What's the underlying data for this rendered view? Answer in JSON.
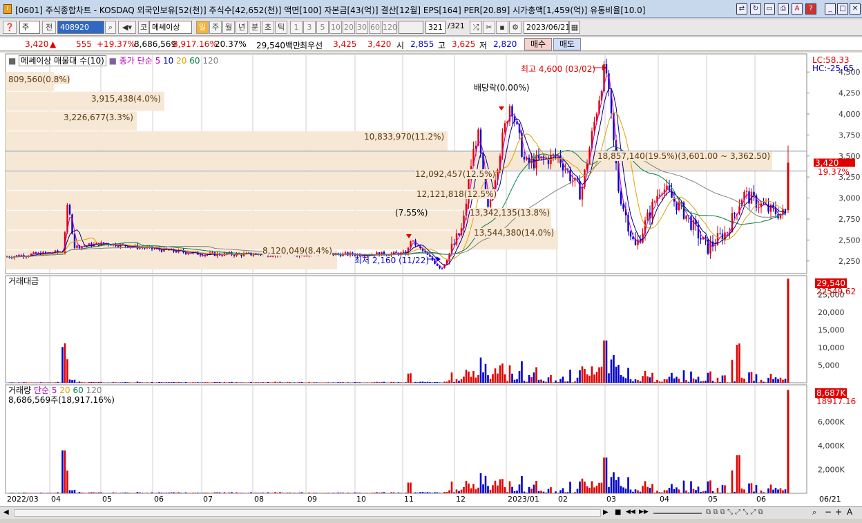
{
  "window": {
    "title": "[0601] 주식종합차트 - KOSDAQ 외국인보유[52(천)] 주식수[42,652(천)] 액면[100] 자본금[43(억)] 결산[12월] EPS[164] PER[20.89] 시가총액[1,459(억)] 유통비율[10.0]",
    "buttons": [
      "minimize",
      "restore",
      "close"
    ]
  },
  "toolbar": {
    "type_label": "주",
    "jeon_label": "전",
    "code": "408920",
    "market_label": "코",
    "stock_name": "메쎄이상",
    "periods": [
      "일",
      "주",
      "월",
      "년",
      "분",
      "초",
      "틱"
    ],
    "active_period": "일",
    "intervals": [
      "1",
      "3",
      "5",
      "10",
      "20",
      "30",
      "60",
      "120"
    ],
    "count": "321",
    "count_total": "/321",
    "date": "2023/06/21"
  },
  "info": {
    "price": "3,420",
    "change": "555",
    "change_pct": "+19.37%",
    "volume": "8,686,569",
    "volume_pct": "8,917.16%",
    "turnover": "20.37%",
    "amount": "29,540백만",
    "best_label": "최우선",
    "ask": "3,425",
    "bid": "3,420",
    "open_label": "시",
    "open": "2,855",
    "high_label": "고",
    "high": "3,625",
    "low_label": "저",
    "low": "2,820",
    "buy_label": "매수",
    "sell_label": "매도"
  },
  "price_panel": {
    "legend_volume_profile": "메쎄이상 매물대 수(10)",
    "legend_ma": "종가 단순",
    "ma_periods": [
      "5",
      "10",
      "20",
      "60",
      "120"
    ],
    "lc": "LC:58.33",
    "hc": "HC:-25.65",
    "current_price_tag": "3,420",
    "current_pct_tag": "19.37%",
    "high_annotation": "최고 4,600 (03/02)",
    "low_annotation": "최저 2,160 (11/22)",
    "dividend_annotation": "배당락(0.00%)",
    "jump_annotation": "(7.55%)"
  },
  "volume_profile": [
    {
      "label": "809,560(0.8%)"
    },
    {
      "label": "3,915,438(4.0%)"
    },
    {
      "label": "3,226,677(3.3%)"
    },
    {
      "label": "10,833,970(11.2%)"
    },
    {
      "label": "18,857,140(19.5%)(3,601.00 ~ 3,362.50)"
    },
    {
      "label": "12,092,457(12.5%)"
    },
    {
      "label": "12,121,818(12.5%)"
    },
    {
      "label": "13,342,135(13.8%)"
    },
    {
      "label": "13,544,380(14.0%)"
    },
    {
      "label": "8,120,049(8.4%)"
    }
  ],
  "amount_panel": {
    "title": "거래대금",
    "current_tag": "29,540",
    "ma_tag": "22549.62",
    "ticks": [
      "25,000",
      "20,000",
      "15,000",
      "10,000",
      "5,000"
    ]
  },
  "volume_panel": {
    "title": "거래량",
    "ma_label": "단순",
    "ma_periods": [
      "5",
      "20",
      "60",
      "120"
    ],
    "summary": "8,686,569주(18,917.16%)",
    "current_tag": "8,687K",
    "ma_tag": "18917.16",
    "ticks": [
      "6,000K",
      "4,000K",
      "2,000K"
    ]
  },
  "x_axis": [
    "2022/03",
    "04",
    "05",
    "06",
    "07",
    "08",
    "09",
    "10",
    "11",
    "12",
    "2023/01",
    "02",
    "03",
    "04",
    "05",
    "06"
  ],
  "x_axis_right": "06/21",
  "chart_data": {
    "type": "candlestick",
    "y_ticks": [
      "4,500",
      "4,250",
      "4,000",
      "3,750",
      "3,500",
      "3,250",
      "3,000",
      "2,750",
      "2,500",
      "2,250"
    ],
    "ylim": [
      2100,
      4650
    ],
    "close_path": [
      [
        "2022-03",
        2300
      ],
      [
        "2022-04-05",
        2360
      ],
      [
        "2022-04-08",
        2950
      ],
      [
        "2022-04-12",
        2420
      ],
      [
        "2022-05",
        2460
      ],
      [
        "2022-06",
        2390
      ],
      [
        "2022-07",
        2330
      ],
      [
        "2022-08",
        2330
      ],
      [
        "2022-10",
        2330
      ],
      [
        "2022-11-01",
        2340
      ],
      [
        "2022-11-03",
        2500
      ],
      [
        "2022-11-22",
        2160
      ],
      [
        "2022-12-05",
        2650
      ],
      [
        "2022-12-10",
        3400
      ],
      [
        "2022-12-14",
        3800
      ],
      [
        "2022-12-20",
        2800
      ],
      [
        "2022-12-28",
        3600
      ],
      [
        "2023-01-03",
        4150
      ],
      [
        "2023-01-12",
        3400
      ],
      [
        "2023-02-01",
        3500
      ],
      [
        "2023-02-15",
        3050
      ],
      [
        "2023-03-02",
        4600
      ],
      [
        "2023-03-10",
        3100
      ],
      [
        "2023-03-20",
        2400
      ],
      [
        "2023-04-05",
        3150
      ],
      [
        "2023-04-20",
        2800
      ],
      [
        "2023-05-03",
        2400
      ],
      [
        "2023-05-15",
        2600
      ],
      [
        "2023-05-25",
        3050
      ],
      [
        "2023-06-10",
        2850
      ],
      [
        "2023-06-20",
        2800
      ],
      [
        "2023-06-21",
        3420
      ]
    ]
  },
  "status_bar": {
    "zoom_controls": [
      "◀",
      "▶",
      "■",
      "◀◀",
      "▶▶",
      "+",
      "-",
      "A"
    ]
  }
}
